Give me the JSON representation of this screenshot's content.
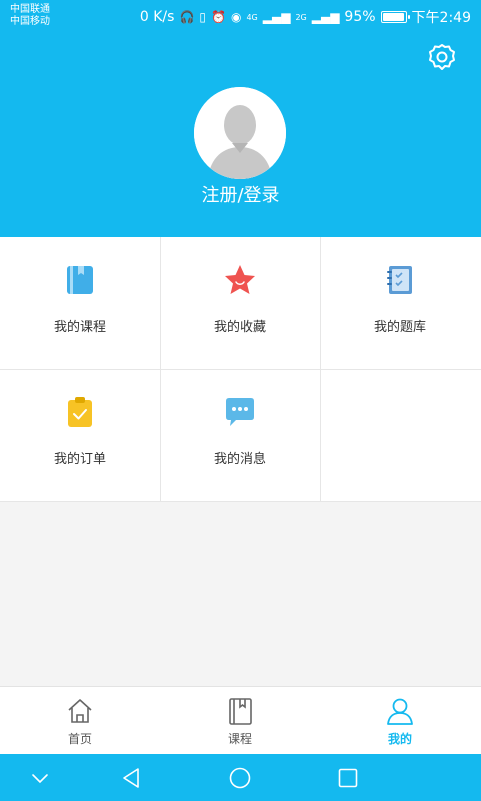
{
  "status": {
    "carrier1": "中国联通",
    "carrier2": "中国移动",
    "speed": "0 K/s",
    "network1": "4G",
    "network2": "2G",
    "battery": "95%",
    "time": "下午2:49"
  },
  "profile": {
    "login_label": "注册/登录"
  },
  "menu": {
    "items": [
      {
        "label": "我的课程",
        "icon": "book-icon"
      },
      {
        "label": "我的收藏",
        "icon": "star-icon"
      },
      {
        "label": "我的题库",
        "icon": "notebook-icon"
      },
      {
        "label": "我的订单",
        "icon": "clipboard-icon"
      },
      {
        "label": "我的消息",
        "icon": "message-icon"
      }
    ]
  },
  "tabs": [
    {
      "label": "首页",
      "icon": "home-icon"
    },
    {
      "label": "课程",
      "icon": "course-book-icon"
    },
    {
      "label": "我的",
      "icon": "user-icon",
      "active": true
    }
  ],
  "colors": {
    "brand": "#14b9ef",
    "star": "#ef5350",
    "clipboard": "#f7c325"
  }
}
